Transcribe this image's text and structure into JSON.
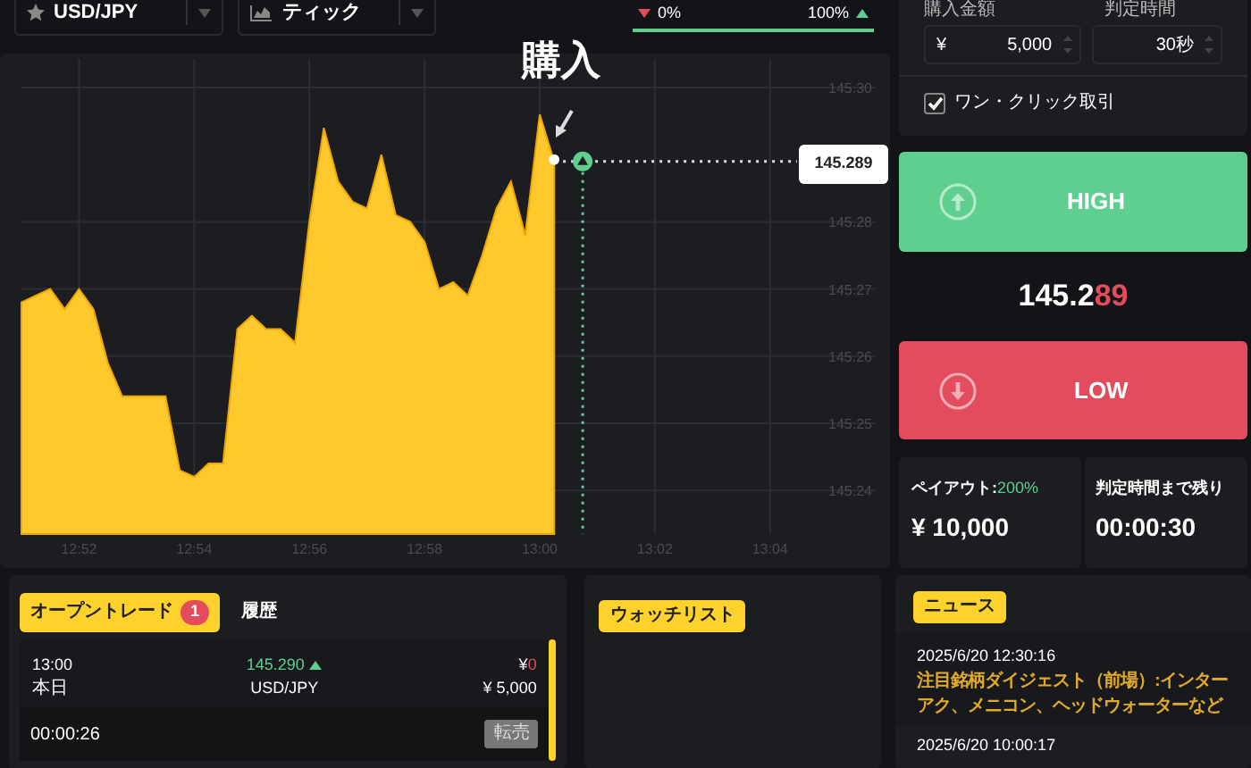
{
  "top_bar": {
    "pair_select": {
      "value": "USD/JPY"
    },
    "chart_type_select": {
      "value": "ティック"
    },
    "sentiment": {
      "down_label": "0%",
      "up_label": "100%",
      "level": 1
    }
  },
  "chart": {
    "marker_label": "購入",
    "price_label": "145.289",
    "chart_data": {
      "type": "area",
      "categories": [
        null,
        null,
        null,
        null,
        "12:52",
        null,
        null,
        null,
        null,
        null,
        null,
        null,
        "12:54",
        null,
        null,
        null,
        null,
        null,
        null,
        null,
        "12:56",
        null,
        null,
        null,
        null,
        null,
        null,
        null,
        "12:58",
        null,
        null,
        null,
        null,
        null,
        null,
        null,
        "13:00",
        null,
        null,
        null,
        null,
        null,
        null,
        null,
        "13:02",
        null,
        null,
        null,
        null,
        null,
        null,
        null,
        "13:04",
        null,
        null
      ],
      "series": [
        {
          "color": "#ffc82c",
          "values": [
            145.268,
            145.269,
            145.27,
            145.267,
            145.27,
            145.267,
            145.259,
            145.254,
            145.254,
            145.254,
            145.254,
            145.243,
            145.242,
            145.244,
            145.244,
            145.264,
            145.266,
            145.264,
            145.264,
            145.262,
            145.28,
            145.294,
            145.286,
            145.283,
            145.282,
            145.29,
            145.281,
            145.28,
            145.277,
            145.27,
            145.271,
            145.269,
            145.275,
            145.282,
            145.286,
            145.278,
            145.296,
            145.289,
            null,
            null,
            null,
            null,
            null,
            null,
            null,
            null,
            null,
            null,
            null,
            null,
            null,
            null,
            null,
            null,
            null
          ]
        }
      ],
      "ylim": [
        145.2335,
        145.3
      ],
      "grid": true,
      "yticks": [
        {
          "value": 145.24,
          "label": "145.24"
        },
        {
          "value": 145.25,
          "label": "145.25"
        },
        {
          "value": 145.26,
          "label": "145.26"
        },
        {
          "value": 145.27,
          "label": "145.27"
        },
        {
          "value": 145.28,
          "label": "145.28"
        },
        {
          "value": 145.3,
          "label": "145.30"
        }
      ]
    }
  },
  "order_panel": {
    "amount_label": "購入金額",
    "amount_currency": "¥",
    "amount_value": "5,000",
    "duration_label": "判定時間",
    "duration_value": "30秒",
    "one_click": {
      "label": "ワン・クリック取引",
      "checked": true
    }
  },
  "high_button": "HIGH",
  "current_price": {
    "main": "145.2",
    "tail": "89"
  },
  "low_button": "LOW",
  "payout": {
    "label": "ペイアウト:",
    "rate": "200%",
    "amount": "¥ 10,000"
  },
  "remaining": {
    "label": "判定時間まで残り",
    "time": "00:00:30"
  },
  "trades_panel": {
    "tabs": [
      {
        "label": "オープントレード",
        "badge": "1",
        "selected": true
      },
      {
        "label": "履歴",
        "selected": false
      }
    ],
    "trades": [
      {
        "time": "13:00",
        "day": "本日",
        "price": "145.290",
        "rising": true,
        "pair": "USD/JPY",
        "currency": "¥",
        "profit": "0",
        "stake": "¥ 5,000",
        "countdown": "00:00:26",
        "action": "転売"
      }
    ]
  },
  "watchlist": {
    "tab": "ウォッチリスト"
  },
  "news": {
    "tab": "ニュース",
    "items": [
      {
        "time": "2025/6/20 12:30:16",
        "title": "注目銘柄ダイジェスト（前場）:インターアク、メニコン、ヘッドウォーターなど"
      },
      {
        "time": "2025/6/20 10:00:17"
      }
    ]
  }
}
